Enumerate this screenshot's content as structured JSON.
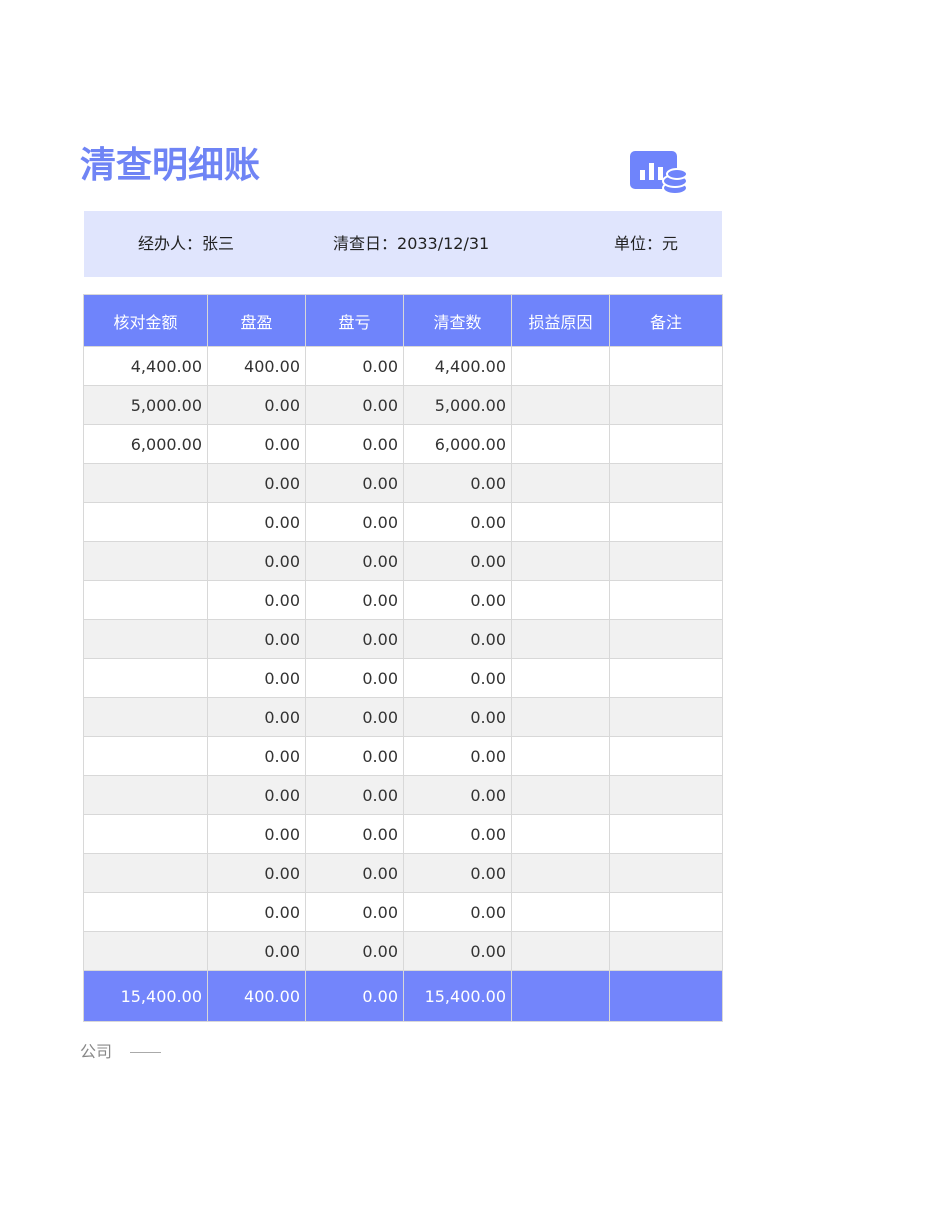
{
  "document": {
    "title": "清查明细账",
    "handler_label": "经办人：",
    "handler_value": "张三",
    "date_label": "清查日：",
    "date_value": "2033/12/31",
    "unit_label": "单位：",
    "unit_value": "元",
    "footer_text": "公司"
  },
  "colors": {
    "accent": "#6f84fb",
    "info_bar": "#e0e5fd",
    "row_alt": "#f1f1f1"
  },
  "table": {
    "headers": [
      "核对金额",
      "盘盈",
      "盘亏",
      "清查数",
      "损益原因",
      "备注"
    ],
    "rows": [
      [
        "4,400.00",
        "400.00",
        "0.00",
        "4,400.00",
        "",
        ""
      ],
      [
        "5,000.00",
        "0.00",
        "0.00",
        "5,000.00",
        "",
        ""
      ],
      [
        "6,000.00",
        "0.00",
        "0.00",
        "6,000.00",
        "",
        ""
      ],
      [
        "",
        "0.00",
        "0.00",
        "0.00",
        "",
        ""
      ],
      [
        "",
        "0.00",
        "0.00",
        "0.00",
        "",
        ""
      ],
      [
        "",
        "0.00",
        "0.00",
        "0.00",
        "",
        ""
      ],
      [
        "",
        "0.00",
        "0.00",
        "0.00",
        "",
        ""
      ],
      [
        "",
        "0.00",
        "0.00",
        "0.00",
        "",
        ""
      ],
      [
        "",
        "0.00",
        "0.00",
        "0.00",
        "",
        ""
      ],
      [
        "",
        "0.00",
        "0.00",
        "0.00",
        "",
        ""
      ],
      [
        "",
        "0.00",
        "0.00",
        "0.00",
        "",
        ""
      ],
      [
        "",
        "0.00",
        "0.00",
        "0.00",
        "",
        ""
      ],
      [
        "",
        "0.00",
        "0.00",
        "0.00",
        "",
        ""
      ],
      [
        "",
        "0.00",
        "0.00",
        "0.00",
        "",
        ""
      ],
      [
        "",
        "0.00",
        "0.00",
        "0.00",
        "",
        ""
      ],
      [
        "",
        "0.00",
        "0.00",
        "0.00",
        "",
        ""
      ]
    ],
    "totals": [
      "15,400.00",
      "400.00",
      "0.00",
      "15,400.00",
      "",
      ""
    ]
  },
  "icons": {
    "logo": "chart-coins-icon"
  }
}
